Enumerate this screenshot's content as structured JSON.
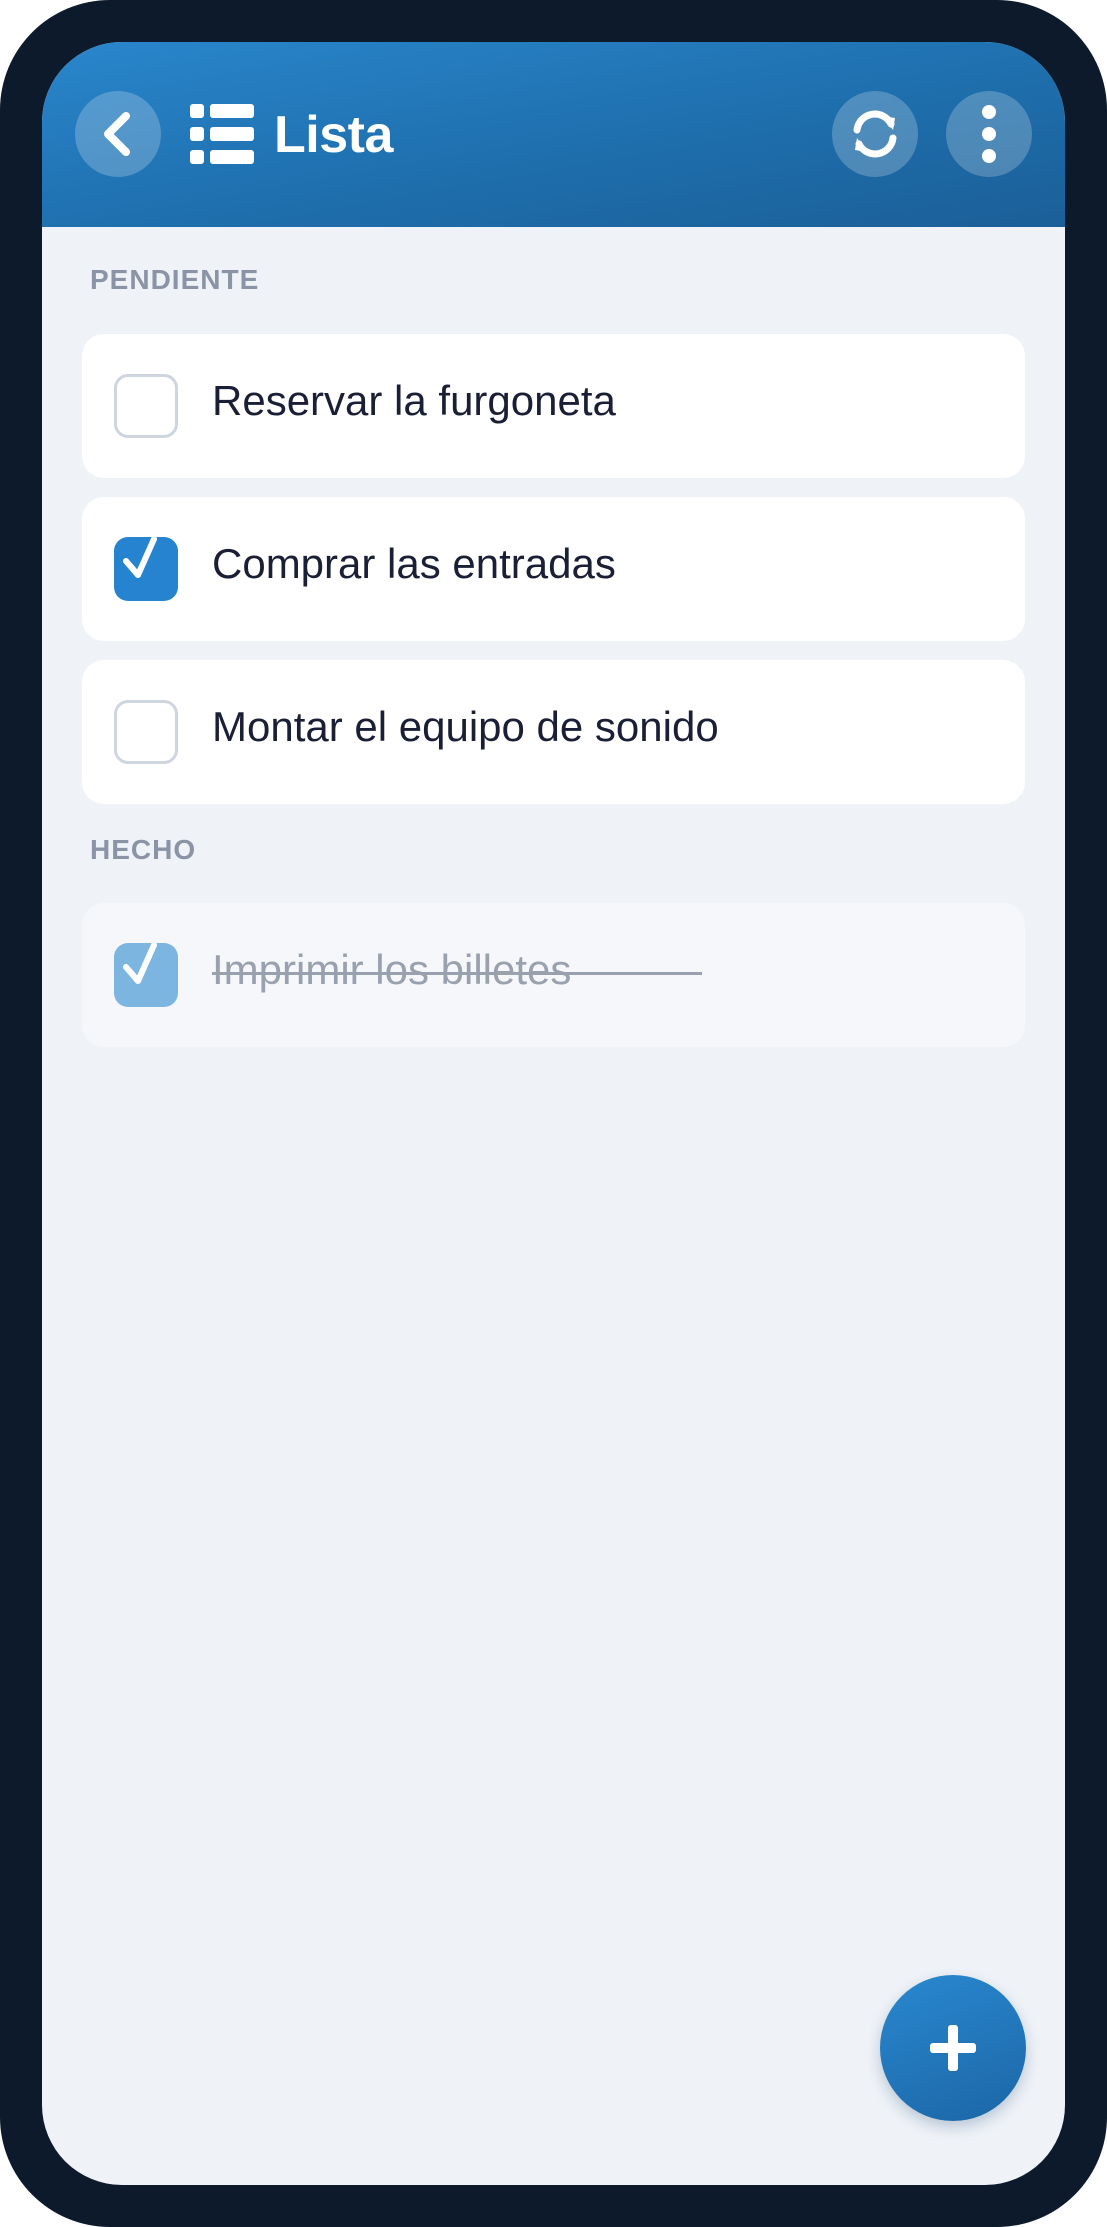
{
  "appbar": {
    "title": "Lista",
    "back_icon": "chevron-left-icon",
    "title_icon": "list-icon",
    "sync_icon": "sync-icon",
    "more_icon": "more-vertical-icon"
  },
  "sections": {
    "pending_label": "PENDIENTE",
    "done_label": "HECHO"
  },
  "pending_items": [
    {
      "label": "Reservar la furgoneta",
      "checked": false
    },
    {
      "label": "Comprar las entradas",
      "checked": true
    },
    {
      "label": "Montar el equipo de sonido",
      "checked": false
    }
  ],
  "done_items": [
    {
      "label": "Imprimir los billetes",
      "checked": true
    }
  ],
  "fab": {
    "icon": "plus-icon"
  },
  "colors": {
    "accent": "#2683cf",
    "appbar": "#1e6fad",
    "background": "#eff2f7",
    "section_label": "#8a94a6",
    "text": "#1a1f36",
    "muted": "#99a1ae"
  }
}
